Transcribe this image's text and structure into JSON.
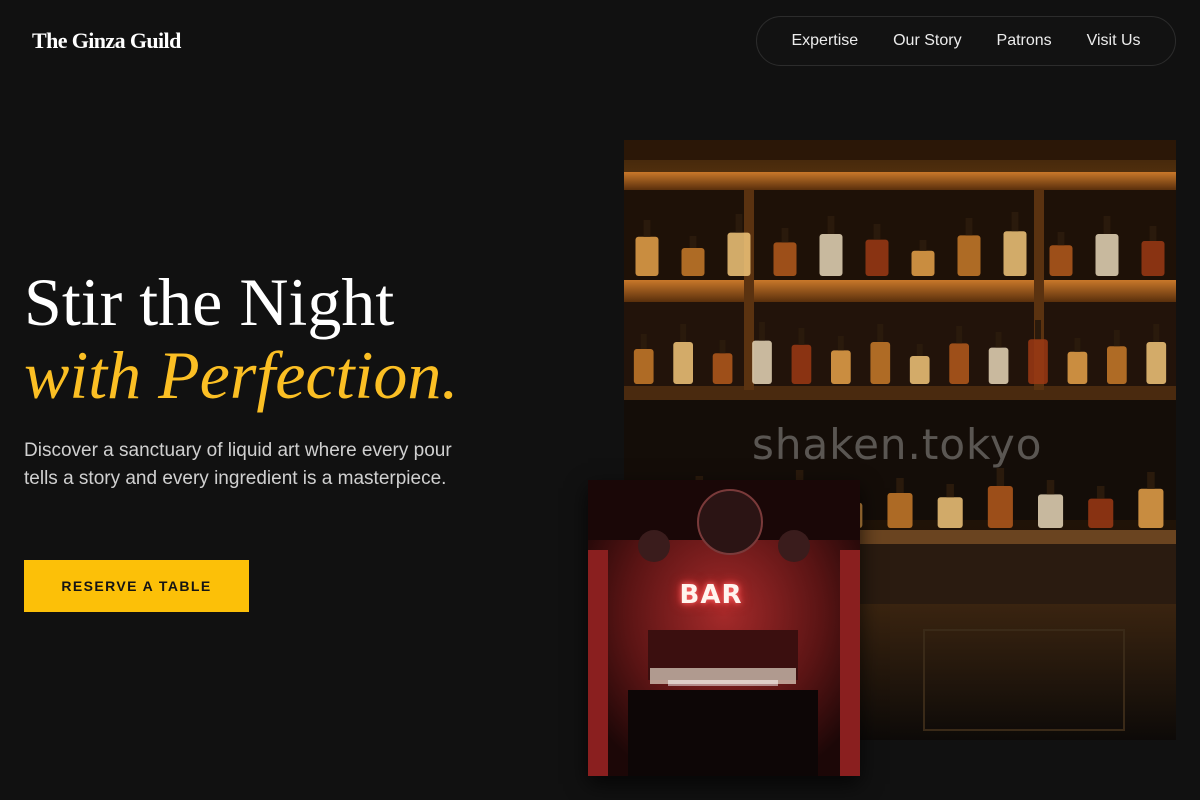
{
  "brand": {
    "name": "The Ginza Guild"
  },
  "nav": {
    "items": [
      {
        "label": "Expertise"
      },
      {
        "label": "Our Story"
      },
      {
        "label": "Patrons"
      },
      {
        "label": "Visit Us"
      }
    ]
  },
  "hero": {
    "title_line1": "Stir the Night",
    "title_line2": "with Perfection.",
    "subtitle": "Discover a sanctuary of liquid art where every pour tells a story and every ingredient is a masterpiece.",
    "cta_label": "RESERVE A TABLE"
  },
  "images": {
    "main_watermark": "shaken.tokyo",
    "inset_sign": "BAR"
  },
  "colors": {
    "background": "#111111",
    "accent": "#fbbf24",
    "cta": "#fcc008"
  }
}
